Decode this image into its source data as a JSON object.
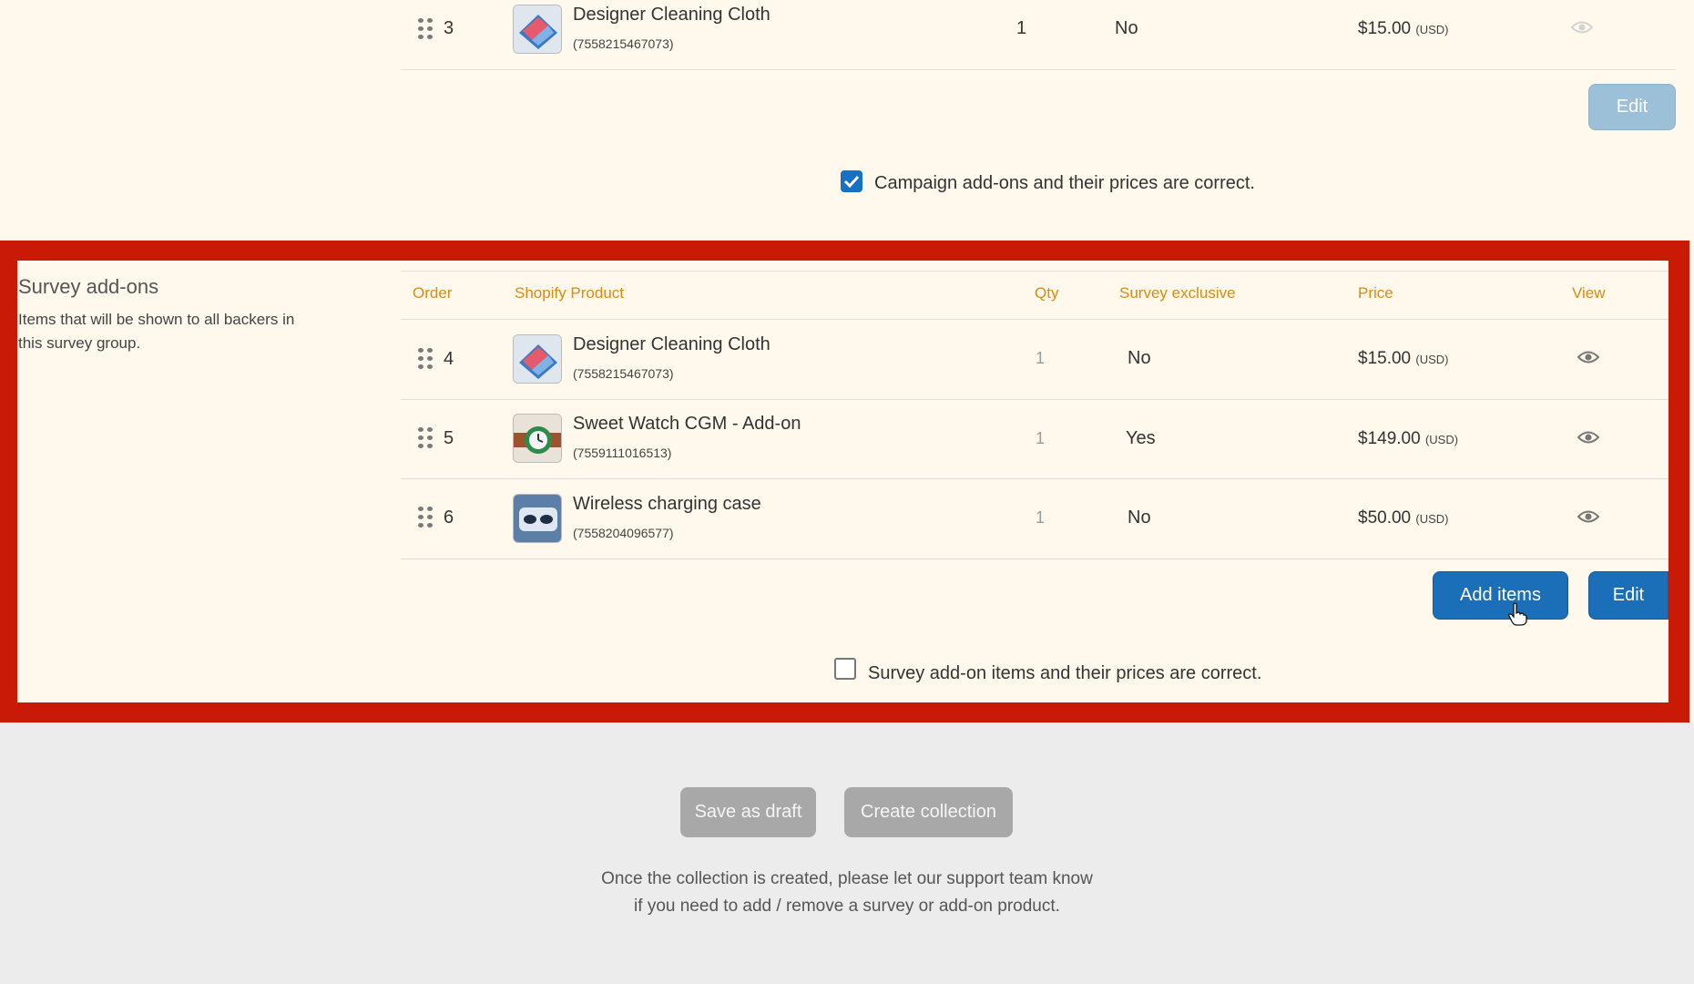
{
  "campaign": {
    "row": {
      "order": "3",
      "product_name": "Designer Cleaning Cloth",
      "product_id": "(7558215467073)",
      "qty": "1",
      "exclusive": "No",
      "price": "$15.00",
      "currency": "(USD)"
    },
    "edit_label": "Edit",
    "confirm_label": "Campaign add-ons and their prices are correct.",
    "confirmed": true
  },
  "survey": {
    "title": "Survey add-ons",
    "description_line1": "Items that will be shown to all backers in",
    "description_line2": "this survey group.",
    "columns": {
      "order": "Order",
      "product": "Shopify Product",
      "qty": "Qty",
      "exclusive": "Survey exclusive",
      "price": "Price",
      "view": "View"
    },
    "rows": [
      {
        "order": "4",
        "product_name": "Designer Cleaning Cloth",
        "product_id": "(7558215467073)",
        "qty": "1",
        "exclusive": "No",
        "price": "$15.00",
        "currency": "(USD)",
        "thumb_icon": "cleaning-cloth-thumbnail"
      },
      {
        "order": "5",
        "product_name": "Sweet Watch CGM - Add-on",
        "product_id": "(7559111016513)",
        "qty": "1",
        "exclusive": "Yes",
        "price": "$149.00",
        "currency": "(USD)",
        "thumb_icon": "watch-thumbnail"
      },
      {
        "order": "6",
        "product_name": "Wireless charging case",
        "product_id": "(7558204096577)",
        "qty": "1",
        "exclusive": "No",
        "price": "$50.00",
        "currency": "(USD)",
        "thumb_icon": "charging-case-thumbnail"
      }
    ],
    "add_items_label": "Add items",
    "edit_label": "Edit",
    "confirm_label": "Survey add-on items and their prices are correct.",
    "confirmed": false
  },
  "footer": {
    "save_draft_label": "Save as draft",
    "create_collection_label": "Create collection",
    "note_line1": "Once the collection is created, please let our support team know",
    "note_line2": "if you need to add / remove a survey or add-on product."
  },
  "colors": {
    "highlight_frame": "#c81a06",
    "primary_button": "#1a6fb8",
    "column_header": "#d98b12",
    "panel_background": "#fef9ec"
  }
}
